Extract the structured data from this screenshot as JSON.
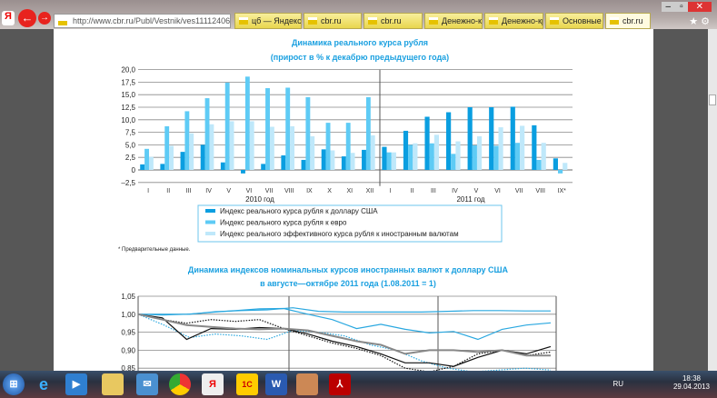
{
  "browser": {
    "address": "http://www.cbr.ru/Publ/Vestnik/ves11112406",
    "tabs": [
      "цб — Яндекс: ...",
      "cbr.ru",
      "cbr.ru",
      "Денежно-кред...",
      "Денежно-кред...",
      "Основные нап...",
      "cbr.ru"
    ],
    "active_tab": 6
  },
  "chart_data": [
    {
      "type": "bar",
      "title": "Динамика реального курса рубля",
      "subtitle": "(прирост в % к декабрю предыдущего года)",
      "ylim": [
        -2.5,
        20
      ],
      "yticks": [
        "20,0",
        "17,5",
        "15,0",
        "12,5",
        "10,0",
        "7,5",
        "5,0",
        "2,5",
        "0",
        "–2,5"
      ],
      "groups": [
        {
          "label": "2010 год",
          "categories": [
            "I",
            "II",
            "III",
            "IV",
            "V",
            "VI",
            "VII",
            "VIII",
            "IX",
            "X",
            "XI",
            "XII"
          ]
        },
        {
          "label": "2011 год",
          "categories": [
            "I",
            "II",
            "III",
            "IV",
            "V",
            "VI",
            "VII",
            "VIII",
            "IX*"
          ]
        }
      ],
      "series": [
        {
          "name": "Индекс реального курса рубля к доллару США",
          "color": "#0a9ee0",
          "values": [
            1.1,
            1.2,
            3.6,
            5.0,
            1.5,
            -0.7,
            1.2,
            2.9,
            2.0,
            4.1,
            2.7,
            4.0,
            4.6,
            7.8,
            10.6,
            11.5,
            12.5,
            12.5,
            12.6,
            8.9,
            2.3
          ]
        },
        {
          "name": "Индекс реального курса рубля к евро",
          "color": "#5ecbf5",
          "values": [
            4.2,
            8.7,
            11.7,
            14.3,
            17.4,
            18.6,
            16.3,
            16.4,
            14.5,
            9.4,
            9.4,
            14.5,
            3.5,
            5.0,
            5.3,
            3.2,
            4.9,
            4.8,
            5.4,
            2.0,
            -0.7
          ]
        },
        {
          "name": "Индекс реального эффективного курса рубля к иностранным валютам",
          "color": "#bfe8fa",
          "values": [
            2.6,
            4.8,
            7.3,
            9.1,
            9.7,
            9.7,
            8.6,
            8.7,
            6.7,
            3.9,
            3.4,
            6.9,
            3.5,
            5.3,
            7.0,
            5.7,
            6.7,
            8.5,
            8.8,
            5.4,
            1.4
          ]
        }
      ],
      "footnote": "* Предварительные данные."
    },
    {
      "type": "line",
      "title": "Динамика индексов номинальных курсов иностранных валют к доллару США",
      "subtitle": "в августе—октябре 2011 года (1.08.2011 = 1)",
      "ylim": [
        0.85,
        1.05
      ],
      "yticks": [
        "1,05",
        "1,00",
        "0,95",
        "0,90",
        "0,85"
      ],
      "series": [
        {
          "style": "solid",
          "color": "#2aa8e0",
          "values": [
            1.0,
            1.0,
            1.0,
            1.007,
            1.01,
            1.012,
            1.018,
            1.008,
            1.006,
            1.006,
            1.006,
            1.006,
            1.008,
            1.01,
            1.01,
            1.009,
            1.009
          ]
        },
        {
          "style": "solid",
          "color": "#2aa8e0",
          "values": [
            1.0,
            0.998,
            1.0,
            1.005,
            1.01,
            1.015,
            1.016,
            1.0,
            0.985,
            0.96,
            0.972,
            0.958,
            0.948,
            0.952,
            0.93,
            0.958,
            0.97,
            0.976
          ]
        },
        {
          "style": "dotted",
          "color": "#2aa8e0",
          "values": [
            1.0,
            0.97,
            0.935,
            0.945,
            0.94,
            0.93,
            0.955,
            0.95,
            0.94,
            0.915,
            0.9,
            0.87,
            0.85,
            0.84,
            0.845,
            0.85,
            0.845
          ]
        },
        {
          "style": "solid",
          "color": "#111111",
          "values": [
            1.0,
            0.99,
            0.93,
            0.96,
            0.958,
            0.963,
            0.96,
            0.945,
            0.925,
            0.91,
            0.89,
            0.865,
            0.865,
            0.855,
            0.88,
            0.9,
            0.89,
            0.91
          ]
        },
        {
          "style": "dotted",
          "color": "#111111",
          "values": [
            1.0,
            0.985,
            0.975,
            0.985,
            0.98,
            0.985,
            0.96,
            0.94,
            0.92,
            0.905,
            0.885,
            0.85,
            0.84,
            0.855,
            0.89,
            0.9,
            0.885,
            0.895
          ]
        },
        {
          "style": "thick",
          "color": "#888888",
          "values": [
            1.0,
            0.985,
            0.97,
            0.965,
            0.96,
            0.958,
            0.96,
            0.955,
            0.94,
            0.925,
            0.915,
            0.89,
            0.9,
            0.9,
            0.895,
            0.9,
            0.885,
            0.885
          ]
        }
      ]
    }
  ],
  "taskbar": {
    "lang": "RU",
    "time": "18:38",
    "date": "29.04.2013"
  }
}
